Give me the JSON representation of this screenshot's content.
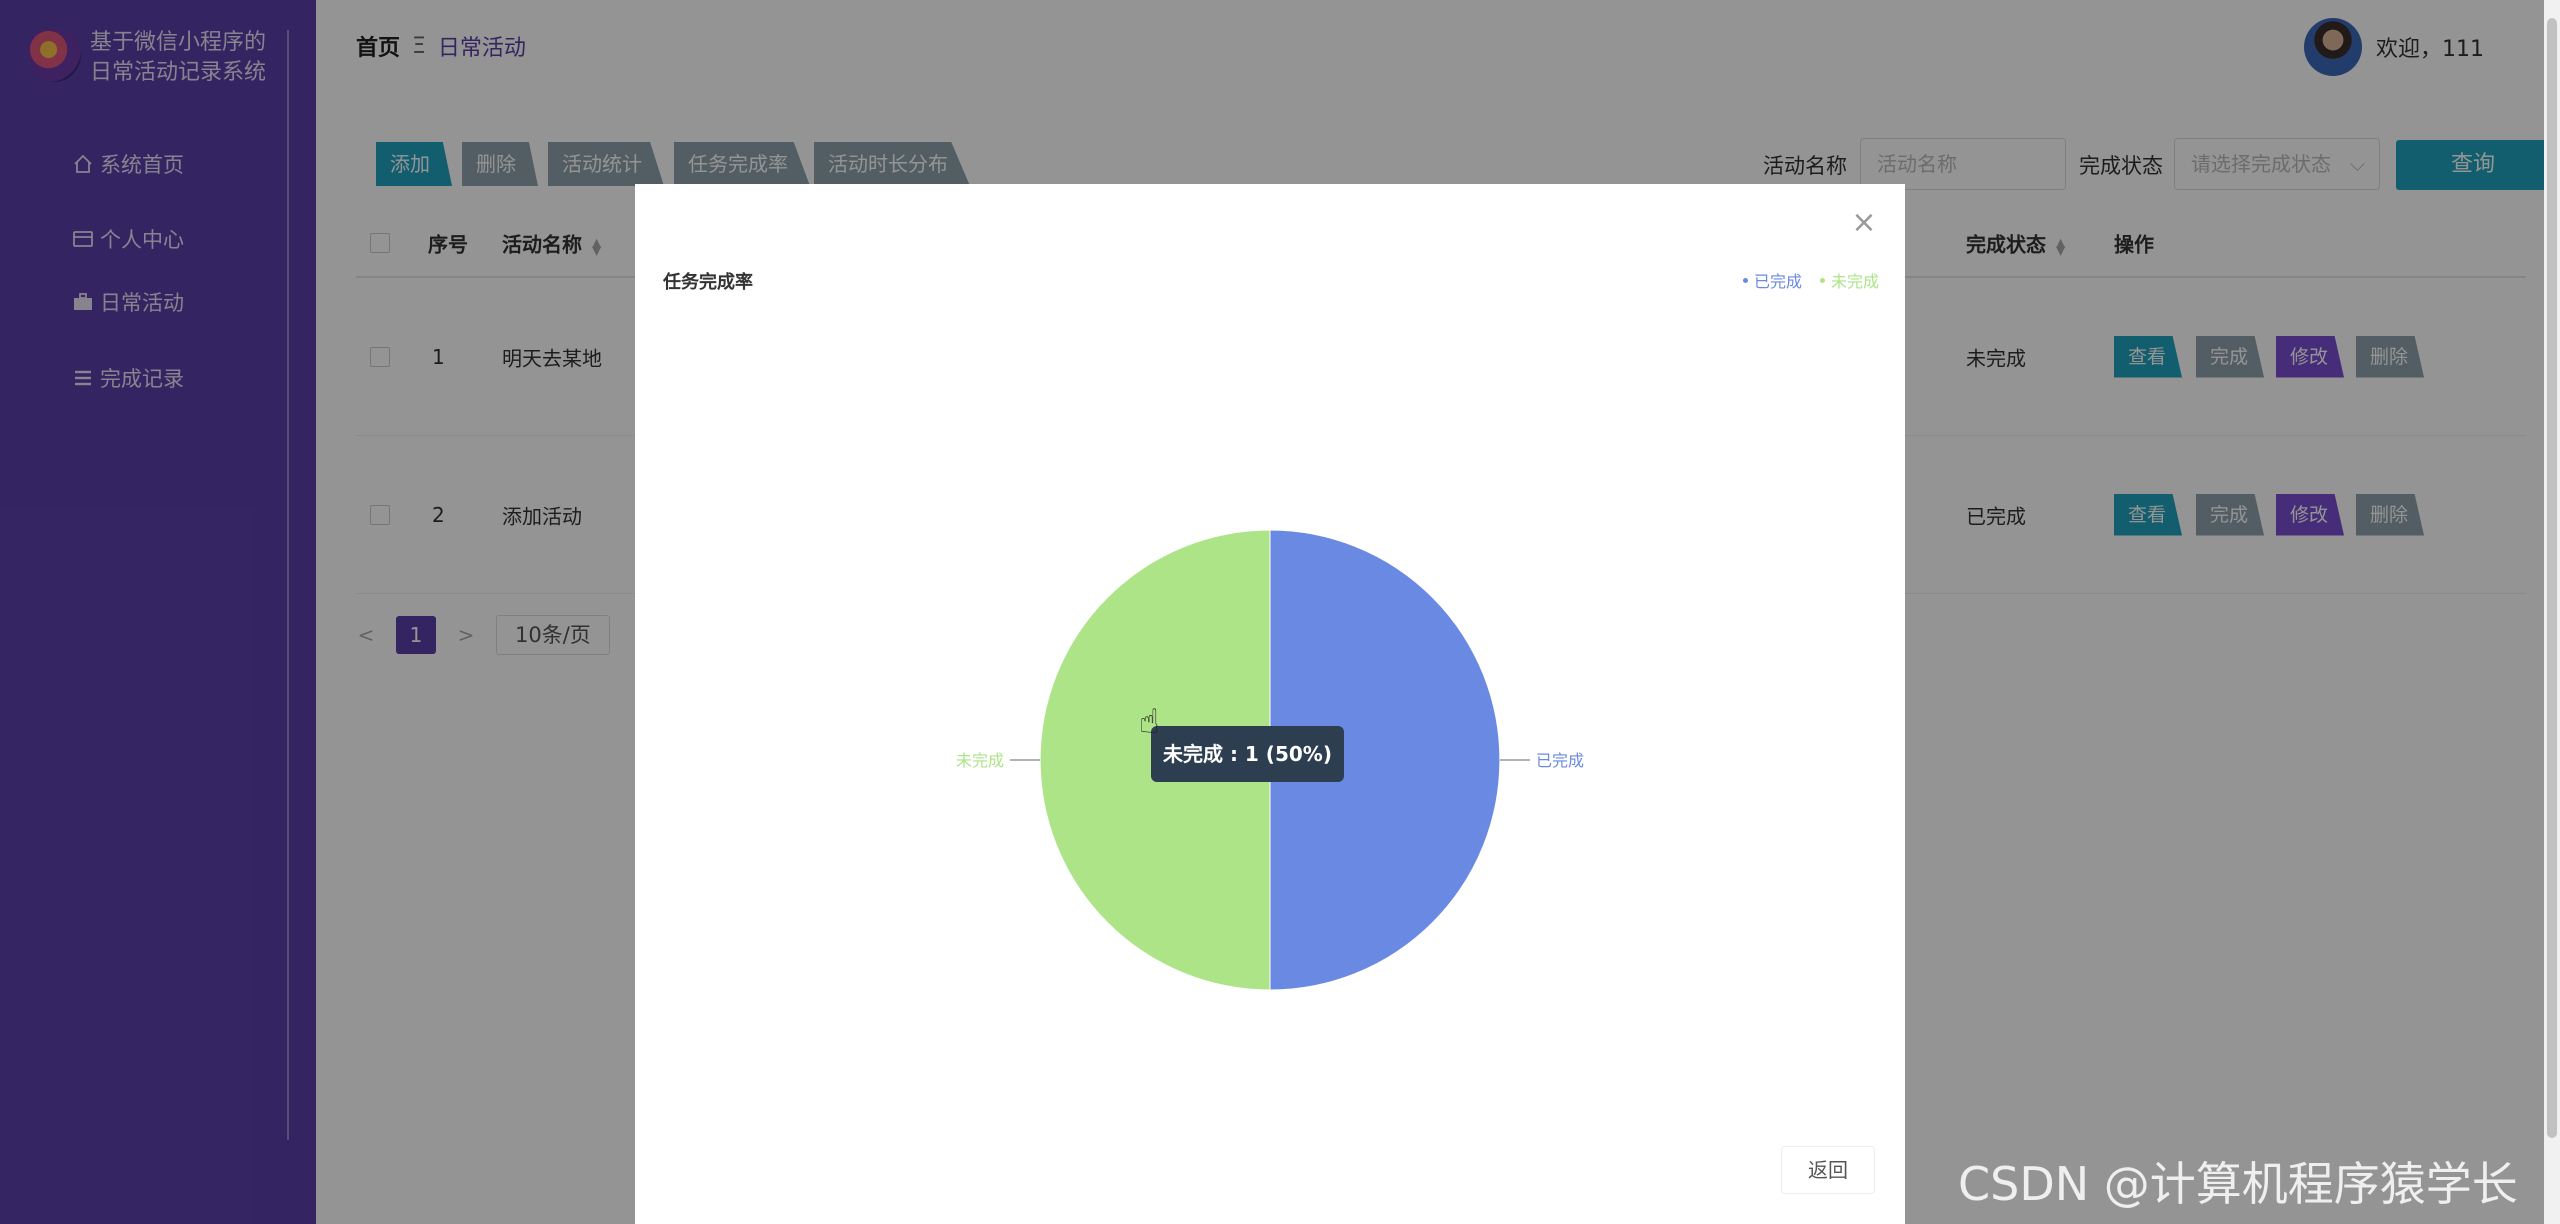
{
  "app": {
    "title": "基于微信小程序的日常活动记录系统"
  },
  "sidebar": {
    "items": [
      {
        "label": "系统首页",
        "icon": "home-icon"
      },
      {
        "label": "个人中心",
        "icon": "card-icon"
      },
      {
        "label": "日常活动",
        "icon": "briefcase-icon"
      },
      {
        "label": "完成记录",
        "icon": "list-icon"
      }
    ]
  },
  "breadcrumb": {
    "home": "首页",
    "separator": "Ξ",
    "current": "日常活动"
  },
  "user": {
    "greeting": "欢迎，111"
  },
  "toolbar": {
    "add": "添加",
    "delete": "删除",
    "stats": "活动统计",
    "completion_rate": "任务完成率",
    "duration_dist": "活动时长分布"
  },
  "search": {
    "name_label": "活动名称",
    "name_placeholder": "活动名称",
    "status_label": "完成状态",
    "status_placeholder": "请选择完成状态",
    "query_label": "查询"
  },
  "table": {
    "headers": {
      "index": "序号",
      "name": "活动名称",
      "status": "完成状态",
      "ops": "操作"
    },
    "rows": [
      {
        "index": "1",
        "name": "明天去某地",
        "status": "未完成"
      },
      {
        "index": "2",
        "name": "添加活动",
        "status": "已完成"
      }
    ],
    "actions": {
      "view": "查看",
      "complete": "完成",
      "edit": "修改",
      "delete": "删除"
    }
  },
  "pager": {
    "prev": "<",
    "current": "1",
    "next": ">",
    "page_size": "10条/页"
  },
  "dialog": {
    "close": "×",
    "back": "返回",
    "tooltip": "未完成 : 1 (50%)"
  },
  "chart_data": {
    "type": "pie",
    "title": "任务完成率",
    "legend_position": "top-right",
    "slices": [
      {
        "name": "已完成",
        "value": 1,
        "color": "#6a89e2"
      },
      {
        "name": "未完成",
        "value": 1,
        "color": "#ade488"
      }
    ]
  },
  "watermark": "CSDN @计算机程序猿学长",
  "colors": {
    "sidebar": "#5b3fa8",
    "accent": "#5b3fa8",
    "teal": "#1fa3bd",
    "gray": "#8fa3ad",
    "purple": "#7a4fd0"
  }
}
